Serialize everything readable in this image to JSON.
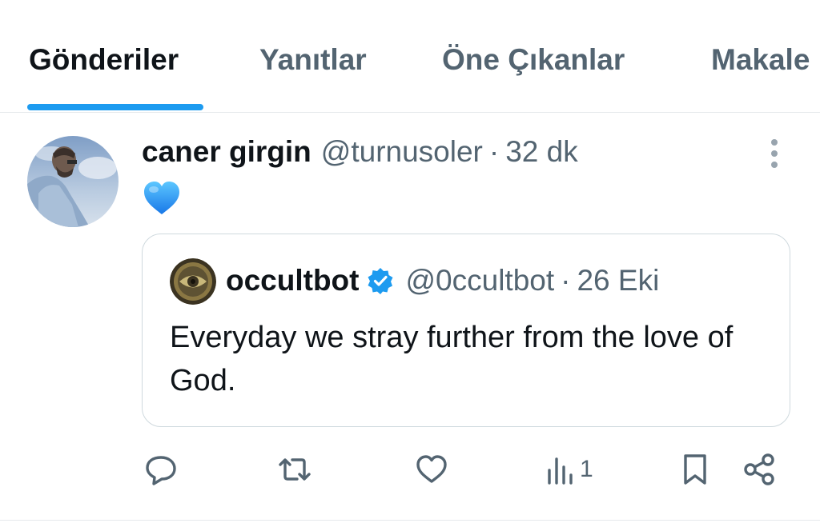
{
  "tabs": [
    {
      "label": "Gönderiler",
      "active": true
    },
    {
      "label": "Yanıtlar",
      "active": false
    },
    {
      "label": "Öne Çıkanlar",
      "active": false
    },
    {
      "label": "Makale",
      "active": false
    }
  ],
  "post": {
    "display_name": "caner girgin",
    "handle": "@turnusoler",
    "separator": "·",
    "time": "32 dk",
    "emoji": "blue-heart-emoji"
  },
  "quote": {
    "display_name": "occultbot",
    "verified": true,
    "handle": "@0ccultbot",
    "separator": "·",
    "date": "26 Eki",
    "text": "Everyday we stray further from the love of God."
  },
  "actions": {
    "reply_icon": "reply-icon",
    "repost_icon": "repost-icon",
    "like_icon": "like-icon",
    "views_icon": "views-icon",
    "views_count": "1",
    "bookmark_icon": "bookmark-icon",
    "share_icon": "share-icon"
  },
  "colors": {
    "accent": "#1d9bf0",
    "text": "#0f1419",
    "muted": "#536471",
    "border": "#cfd9de"
  }
}
